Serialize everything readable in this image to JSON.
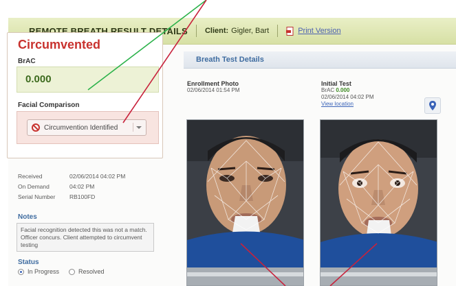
{
  "header": {
    "title": "REMOTE BREATH RESULT DETAILS",
    "client_label": "Client:",
    "client_value": "Gigler, Bart",
    "print_label": "Print Version"
  },
  "result": {
    "status": "Circumvented",
    "brac_label": "BrAC",
    "brac_value": "0.000",
    "facial_label": "Facial Comparison",
    "facial_value": "Circumvention Identified"
  },
  "info": {
    "received_label": "Received",
    "received_value": "02/06/2014 04:02 PM",
    "on_demand_label": "On Demand",
    "on_demand_value": "04:02 PM",
    "serial_label": "Serial Number",
    "serial_value": "RB100FD"
  },
  "notes": {
    "label": "Notes",
    "text": "Facial recognition detected this was not a match. Officer concurs. Client attempted to circumvent testing"
  },
  "status_section": {
    "label": "Status",
    "options": [
      "In Progress",
      "Resolved"
    ],
    "selected": "In Progress"
  },
  "breath_test": {
    "title": "Breath Test Details",
    "enrollment_title": "Enrollment Photo",
    "enrollment_date": "02/06/2014 01:54 PM",
    "initial_title": "Initial Test",
    "initial_brac_label": "BrAC",
    "initial_brac_value": "0.000",
    "initial_date": "02/06/2014 04:02 PM",
    "view_location": "View location"
  },
  "colors": {
    "header_bg": "#dfe6b4",
    "status_red": "#c8322e",
    "brac_green": "#3d6b1e",
    "link_blue": "#3a63b8",
    "annotation_green": "#2bb24a",
    "annotation_red": "#c8223c"
  }
}
